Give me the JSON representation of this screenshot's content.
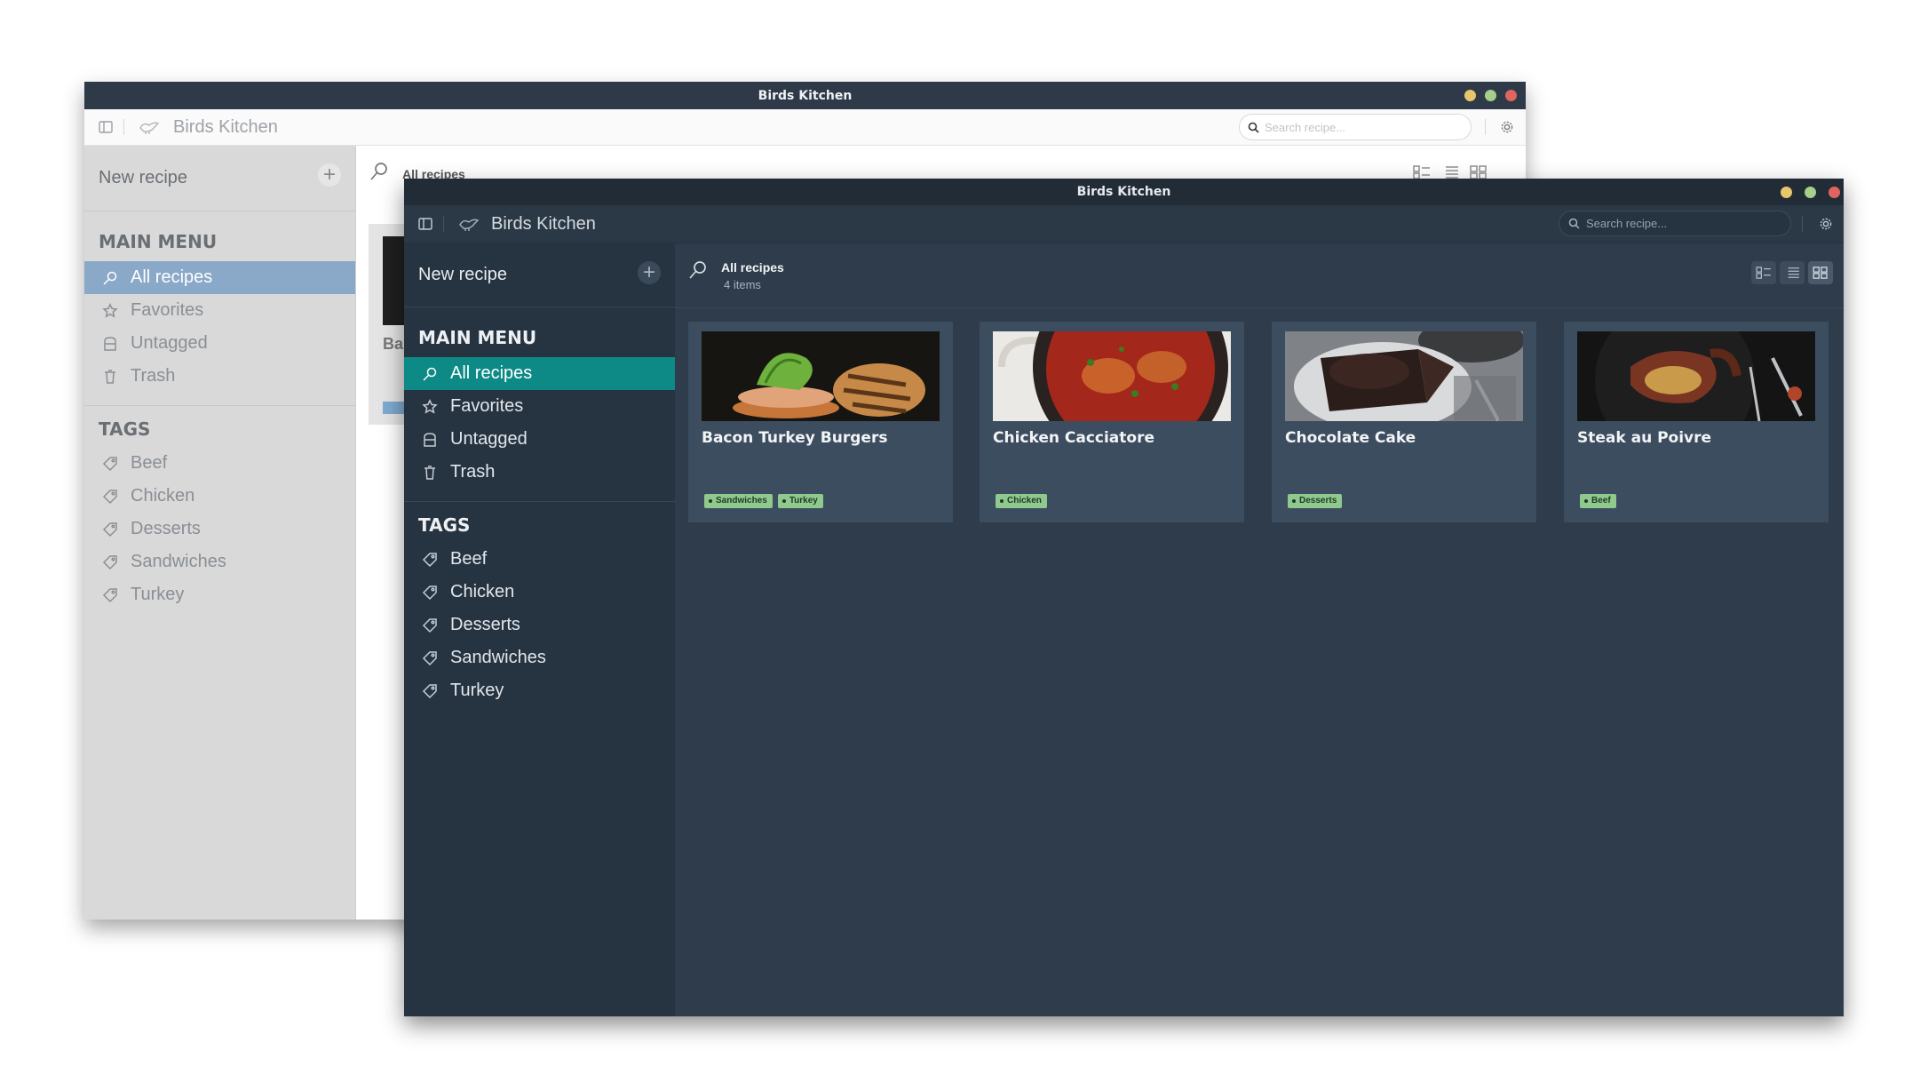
{
  "back_window": {
    "title": "Birds Kitchen",
    "app_name": "Birds Kitchen",
    "search_placeholder": "Search recipe...",
    "new_recipe_label": "New recipe",
    "main_menu_title": "MAIN MENU",
    "menu_items": [
      {
        "label": "All recipes",
        "icon": "search-icon"
      },
      {
        "label": "Favorites",
        "icon": "star-icon"
      },
      {
        "label": "Untagged",
        "icon": "box-icon"
      },
      {
        "label": "Trash",
        "icon": "trash-icon"
      }
    ],
    "tags_title": "TAGS",
    "tags": [
      "Beef",
      "Chicken",
      "Desserts",
      "Sandwiches",
      "Turkey"
    ],
    "header_title": "All recipes",
    "card_title_partial": "Ba"
  },
  "front_window": {
    "title": "Birds Kitchen",
    "app_name": "Birds Kitchen",
    "search_placeholder": "Search recipe...",
    "new_recipe_label": "New recipe",
    "main_menu_title": "MAIN MENU",
    "menu_items": [
      {
        "label": "All recipes",
        "icon": "search-icon",
        "active": true
      },
      {
        "label": "Favorites",
        "icon": "star-icon"
      },
      {
        "label": "Untagged",
        "icon": "box-icon"
      },
      {
        "label": "Trash",
        "icon": "trash-icon"
      }
    ],
    "tags_title": "TAGS",
    "tags": [
      "Beef",
      "Chicken",
      "Desserts",
      "Sandwiches",
      "Turkey"
    ],
    "header_title": "All recipes",
    "header_count": "4 items",
    "recipes": [
      {
        "title": "Bacon Turkey Burgers",
        "tags": [
          "Sandwiches",
          "Turkey"
        ]
      },
      {
        "title": "Chicken Cacciatore",
        "tags": [
          "Chicken"
        ]
      },
      {
        "title": "Chocolate Cake",
        "tags": [
          "Desserts"
        ]
      },
      {
        "title": "Steak au Poivre",
        "tags": [
          "Beef"
        ]
      }
    ]
  },
  "colors": {
    "active_item_front": "#0d8a86",
    "active_item_back": "#8aa8c8",
    "tag_bg": "#8fc98e",
    "dot_yellow": "#e8c66b",
    "dot_green": "#a6cf8a",
    "dot_red": "#e0655f"
  }
}
